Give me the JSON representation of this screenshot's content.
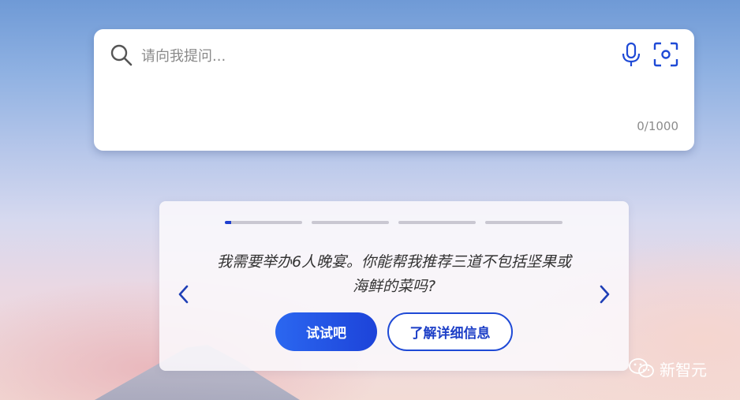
{
  "search": {
    "placeholder": "请向我提问...",
    "char_count": "0/1000"
  },
  "suggestion": {
    "text": "我需要举办6人晚宴。你能帮我推荐三道不包括坚果或海鲜的菜吗?",
    "slides_total": 4,
    "active_slide": 1,
    "try_label": "试试吧",
    "learn_label": "了解详细信息"
  },
  "watermark": {
    "text": "新智元"
  },
  "colors": {
    "accent": "#1f4ad6",
    "background_top": "#6f9ad6",
    "background_bottom": "#f3dcd6"
  },
  "icons": [
    "search-icon",
    "mic-icon",
    "scan-icon",
    "chevron-left-icon",
    "chevron-right-icon",
    "wechat-icon"
  ]
}
